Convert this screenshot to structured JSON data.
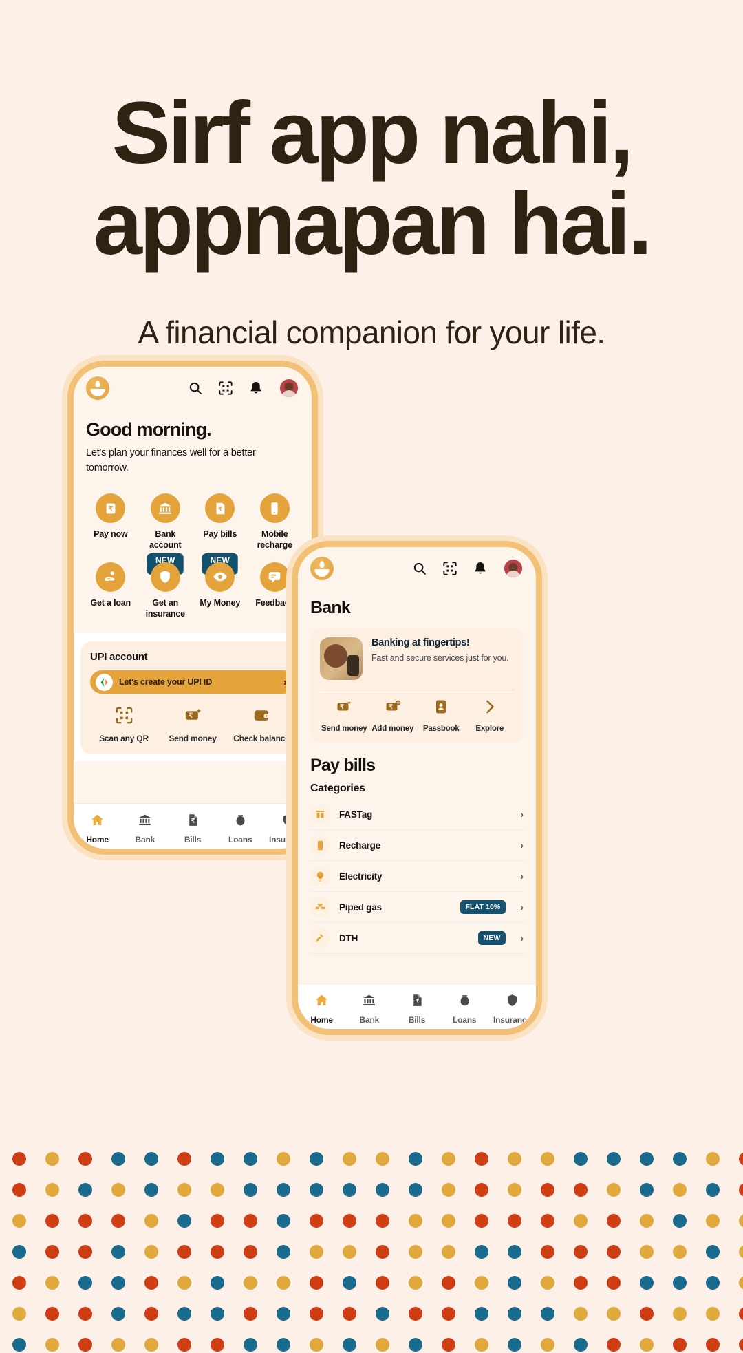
{
  "hero": {
    "title_line1": "Sirf app nahi,",
    "title_line2": "appnapan hai.",
    "subtitle": "A financial companion for your life."
  },
  "colors": {
    "page_bg": "#fdf0e8",
    "text_dark": "#2e2213",
    "accent_orange": "#e5a33b",
    "phone_border": "#f2c076",
    "badge_blue": "#14516e",
    "dot_red": "#cf3d14",
    "dot_blue": "#1a6a8e",
    "dot_yellow": "#e0a93d"
  },
  "phone1": {
    "appbar": {
      "logo": "app-logo",
      "icons": [
        "search-icon",
        "qr-scan-icon",
        "bell-icon"
      ],
      "avatar": "user-avatar"
    },
    "greeting": {
      "title": "Good morning.",
      "subtitle": "Let's plan your finances well for a better tomorrow."
    },
    "quick_actions": [
      {
        "label": "Pay now",
        "icon": "rupee-note-icon",
        "badge": ""
      },
      {
        "label": "Bank account",
        "icon": "bank-icon",
        "badge": ""
      },
      {
        "label": "Pay bills",
        "icon": "bill-rupee-icon",
        "badge": ""
      },
      {
        "label": "Mobile recharge",
        "icon": "mobile-icon",
        "badge": ""
      },
      {
        "label": "Get a loan",
        "icon": "hand-coin-icon",
        "badge": ""
      },
      {
        "label": "Get an insurance",
        "icon": "shield-icon",
        "badge": "NEW"
      },
      {
        "label": "My Money",
        "icon": "eye-icon",
        "badge": "NEW"
      },
      {
        "label": "Feedback",
        "icon": "chat-icon",
        "badge": ""
      }
    ],
    "upi": {
      "title": "UPI account",
      "cta_label": "Let's create your UPI ID",
      "cta_icon": "upi-flag-icon",
      "cta_chevron": "›",
      "actions": [
        {
          "label": "Scan any QR",
          "icon": "qr-scan-icon"
        },
        {
          "label": "Send money",
          "icon": "send-money-icon"
        },
        {
          "label": "Check balance",
          "icon": "wallet-icon"
        }
      ]
    },
    "bottom_nav": [
      {
        "label": "Home",
        "icon": "home-icon",
        "active": true
      },
      {
        "label": "Bank",
        "icon": "bank-icon",
        "active": false
      },
      {
        "label": "Bills",
        "icon": "bills-icon",
        "active": false
      },
      {
        "label": "Loans",
        "icon": "loan-bag-icon",
        "active": false
      },
      {
        "label": "Insurance",
        "icon": "shield-icon",
        "active": false
      }
    ]
  },
  "phone2": {
    "appbar": {
      "logo": "app-logo",
      "icons": [
        "search-icon",
        "qr-scan-icon",
        "bell-icon"
      ],
      "avatar": "user-avatar"
    },
    "bank_section_title": "Bank",
    "bank_card": {
      "photo": "man-with-phone-photo",
      "heading": "Banking at fingertips!",
      "description": "Fast and secure services just for you.",
      "actions": [
        {
          "label": "Send money",
          "icon": "send-money-icon"
        },
        {
          "label": "Add money",
          "icon": "add-money-icon"
        },
        {
          "label": "Passbook",
          "icon": "passbook-icon"
        },
        {
          "label": "Explore",
          "icon": "chevron-right-icon"
        }
      ]
    },
    "paybills_title": "Pay bills",
    "categories_label": "Categories",
    "categories": [
      {
        "name": "FASTag",
        "icon": "fastag-icon",
        "badge": ""
      },
      {
        "name": "Recharge",
        "icon": "mobile-icon",
        "badge": ""
      },
      {
        "name": "Electricity",
        "icon": "bulb-icon",
        "badge": ""
      },
      {
        "name": "Piped gas",
        "icon": "gas-valve-icon",
        "badge": "FLAT 10%"
      },
      {
        "name": "DTH",
        "icon": "dish-antenna-icon",
        "badge": "NEW"
      }
    ],
    "bottom_nav": [
      {
        "label": "Home",
        "icon": "home-icon",
        "active": true
      },
      {
        "label": "Bank",
        "icon": "bank-icon",
        "active": false
      },
      {
        "label": "Bills",
        "icon": "bills-icon",
        "active": false
      },
      {
        "label": "Loans",
        "icon": "loan-bag-icon",
        "active": false
      },
      {
        "label": "Insurance",
        "icon": "shield-icon",
        "active": false
      }
    ]
  }
}
